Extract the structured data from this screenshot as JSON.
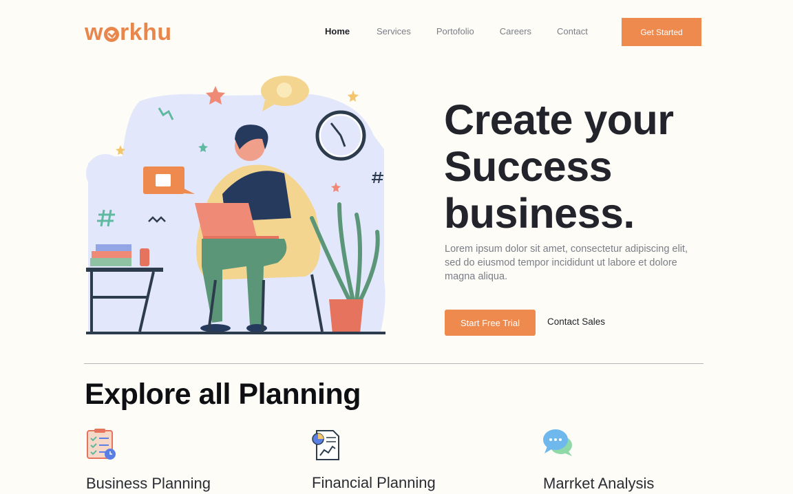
{
  "brand": {
    "logo_prefix": "w",
    "logo_suffix": "rkhu"
  },
  "nav": {
    "items": [
      "Home",
      "Services",
      "Portofolio",
      "Careers",
      "Contact"
    ],
    "cta": "Get Started"
  },
  "hero": {
    "title_line1": "Create your",
    "title_line2": "Success",
    "title_line3": "business.",
    "text": "Lorem ipsum dolor sit amet, consectetur adipiscing elit, sed do eiusmod tempor incididunt ut labore et dolore magna aliqua.",
    "primary_button": "Start Free Trial",
    "secondary_button": "Contact Sales"
  },
  "section": {
    "title": "Explore all Planning",
    "cards": [
      {
        "title": "Business Planning",
        "icon": "checklist-icon"
      },
      {
        "title": "Financial Planning",
        "icon": "financial-report-icon"
      },
      {
        "title": "Marrket Analysis",
        "icon": "chat-bubbles-icon"
      }
    ]
  },
  "colors": {
    "accent": "#ef8a4f",
    "background": "#fdfcf7",
    "text": "#22232b"
  }
}
